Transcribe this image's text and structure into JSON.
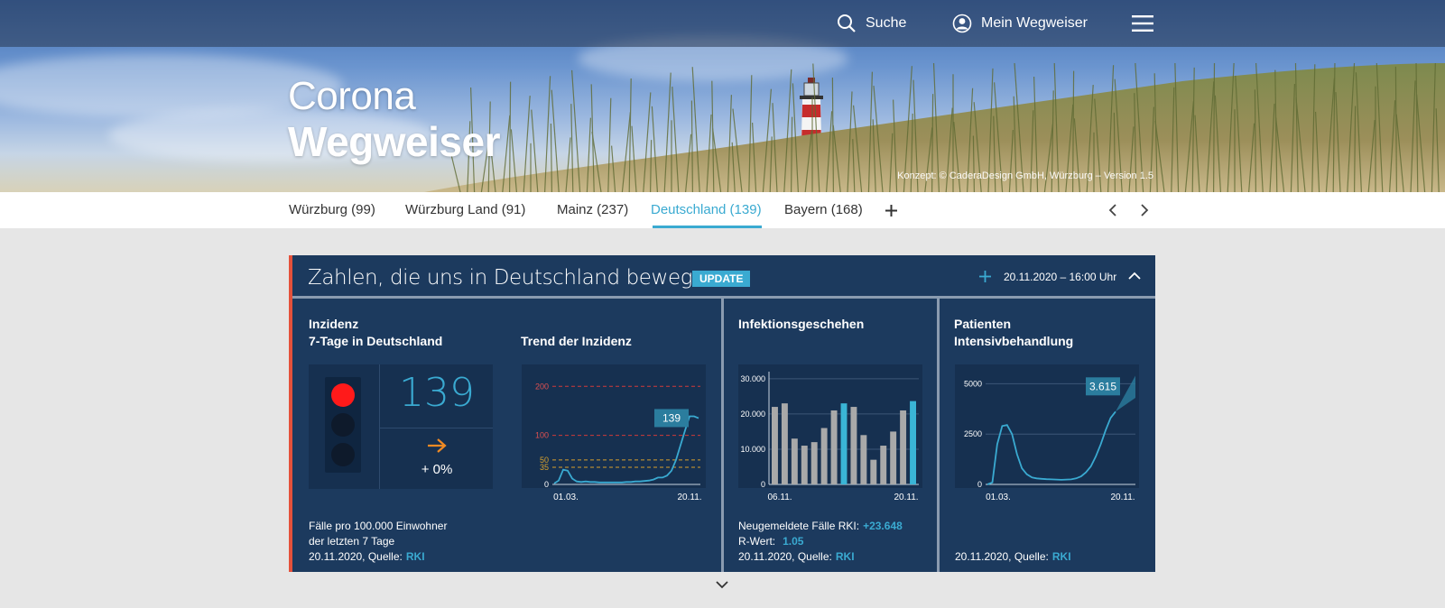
{
  "topbar": {
    "search_label": "Suche",
    "account_label": "Mein Wegweiser"
  },
  "hero": {
    "line1": "Corona",
    "line2": "Wegweiser",
    "credit": "Konzept: © CaderaDesign GmbH, Würzburg – Version 1.5"
  },
  "tabs": [
    {
      "label": "Würzburg (99)"
    },
    {
      "label": "Würzburg Land (91)"
    },
    {
      "label": "Mainz (237)"
    },
    {
      "label": "Deutschland (139)",
      "active": true
    },
    {
      "label": "Bayern (168)"
    }
  ],
  "panel": {
    "title": "Zahlen, die uns in Deutschland bewegen",
    "badge": "UPDATE",
    "date": "20.11.2020 – 16:00 Uhr"
  },
  "inzidenz": {
    "title_line1": "Inzidenz",
    "title_line2": "7-Tage in Deutschland",
    "value": "139",
    "change": "+ 0%",
    "traffic_light": "red",
    "footer_line1": "Fälle pro 100.000 Einwohner",
    "footer_line2": "der letzten 7 Tage",
    "footer_date": "20.11.2020, Quelle:",
    "footer_source": "RKI"
  },
  "trend": {
    "title": "Trend der Inzidenz"
  },
  "infektion": {
    "title": "Infektionsgeschehen",
    "neu_label": "Neugemeldete Fälle RKI:",
    "neu_value": "+23.648",
    "r_label": "R-Wert:",
    "r_value": "1.05",
    "footer_date": "20.11.2020, Quelle:",
    "footer_source": "RKI"
  },
  "patienten": {
    "title_line1": "Patienten",
    "title_line2": "Intensivbehandlung",
    "footer_date": "20.11.2020, Quelle:",
    "footer_source": "RKI"
  },
  "colors": {
    "accent": "#3aaad1",
    "panel": "#1c3a5e",
    "red_bar": "#e4513b",
    "arrow": "#f08a24"
  },
  "chart_data": [
    {
      "type": "line",
      "title": "Trend der Inzidenz",
      "x_ticks": [
        "01.03.",
        "20.11."
      ],
      "y_ticks": [
        0,
        35,
        50,
        100,
        200
      ],
      "reference_lines": [
        {
          "value": 200,
          "color": "#d03a3a"
        },
        {
          "value": 100,
          "color": "#d03a3a"
        },
        {
          "value": 50,
          "color": "#d8a12c"
        },
        {
          "value": 35,
          "color": "#d8a12c"
        }
      ],
      "ylim": [
        0,
        230
      ],
      "series": [
        {
          "values": [
            2,
            8,
            30,
            28,
            12,
            6,
            5,
            6,
            5,
            5,
            4,
            4,
            4,
            4,
            4,
            4,
            5,
            5,
            6,
            6,
            7,
            8,
            10,
            14,
            14,
            18,
            28,
            50,
            80,
            110,
            139,
            139,
            135
          ]
        }
      ],
      "callout": {
        "label": "139",
        "value": 139
      }
    },
    {
      "type": "bar",
      "title": "Infektionsgeschehen",
      "x_ticks": [
        "06.11.",
        "20.11."
      ],
      "y_ticks": [
        "0",
        "10.000",
        "20.000",
        "30.000"
      ],
      "ylim": [
        0,
        32000
      ],
      "values": [
        22000,
        23000,
        13000,
        11000,
        12000,
        16000,
        21000,
        23000,
        22000,
        14000,
        7000,
        11000,
        15000,
        21000,
        23648
      ],
      "highlight_indices": [
        7,
        14
      ]
    },
    {
      "type": "line",
      "title": "Patienten Intensivbehandlung",
      "x_ticks": [
        "01.03.",
        "20.11."
      ],
      "y_ticks": [
        0,
        2500,
        5000
      ],
      "ylim": [
        0,
        5600
      ],
      "series": [
        {
          "values": [
            0,
            100,
            2000,
            2900,
            2950,
            2500,
            1500,
            800,
            500,
            350,
            300,
            280,
            260,
            250,
            240,
            230,
            240,
            250,
            300,
            400,
            600,
            900,
            1400,
            2000,
            2700,
            3300,
            3615
          ]
        }
      ],
      "callout": {
        "label": "3.615",
        "value": 3615
      }
    }
  ]
}
